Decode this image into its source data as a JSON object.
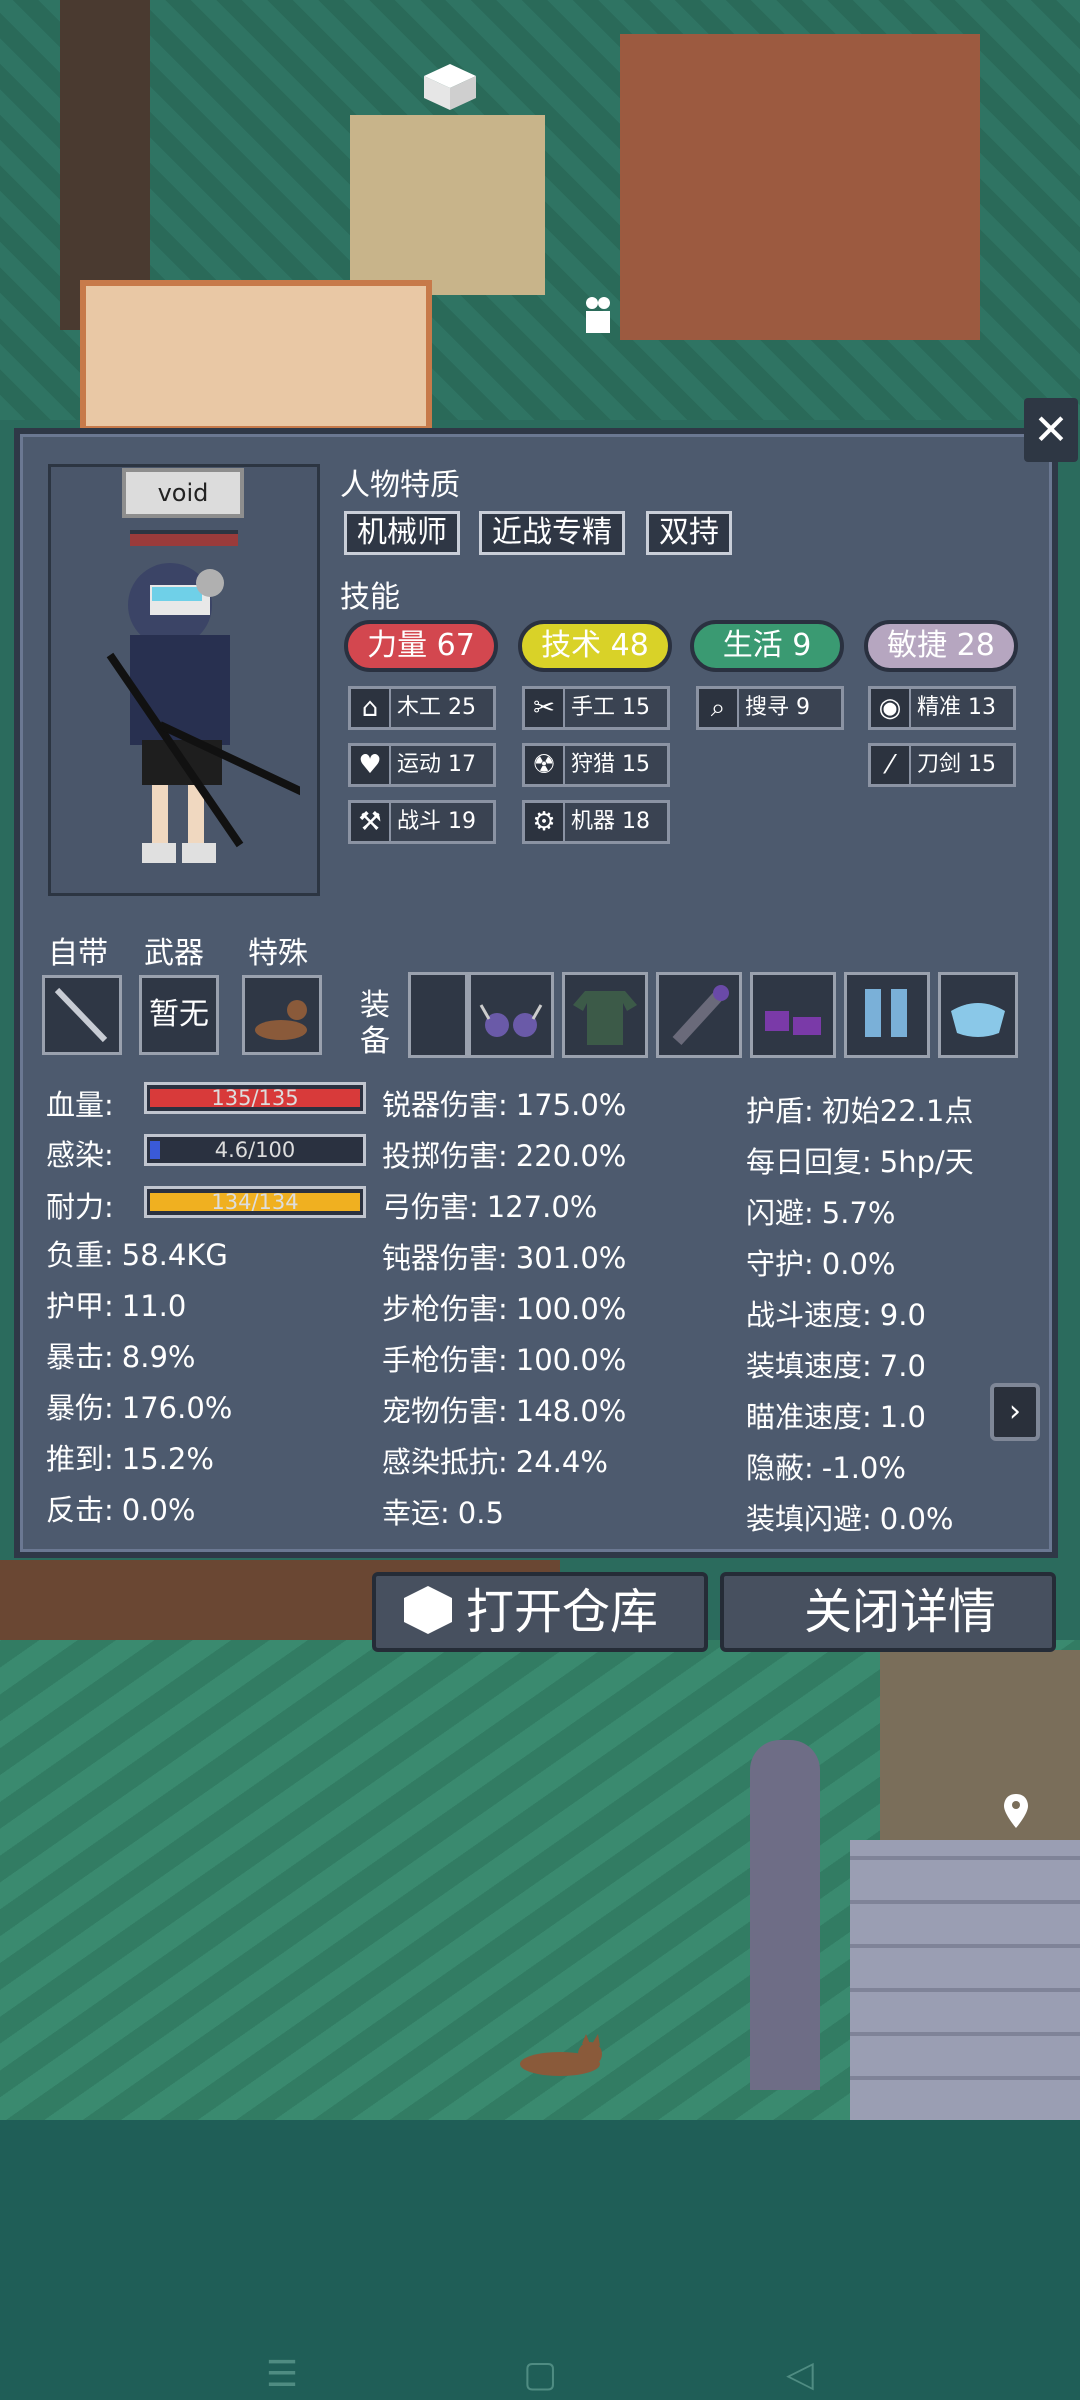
{
  "character": {
    "name": "void"
  },
  "traits": {
    "title": "人物特质",
    "items": [
      "机械师",
      "近战专精",
      "双持"
    ]
  },
  "skills": {
    "title": "技能",
    "main": [
      {
        "label": "力量 67",
        "color": "#d3474f"
      },
      {
        "label": "技术 48",
        "color": "#d9d228"
      },
      {
        "label": "生活 9",
        "color": "#3a9a72"
      },
      {
        "label": "敏捷 28",
        "color": "#b6a6c0"
      }
    ],
    "sub": [
      {
        "label": "木工 25",
        "icon": "house-icon"
      },
      {
        "label": "手工 15",
        "icon": "scissors-icon"
      },
      {
        "label": "搜寻 9",
        "icon": "magnifier-icon"
      },
      {
        "label": "精准 13",
        "icon": "eye-icon"
      },
      {
        "label": "运动 17",
        "icon": "heart-icon"
      },
      {
        "label": "狩猎 15",
        "icon": "radiation-icon"
      },
      {
        "label": "刀剑 15",
        "icon": "blade-icon"
      },
      {
        "label": "战斗 19",
        "icon": "axe-icon"
      },
      {
        "label": "机器 18",
        "icon": "gear-icon"
      }
    ]
  },
  "slots": {
    "builtin_label": "自带",
    "weapon_label": "武器",
    "special_label": "特殊",
    "weapon_empty": "暂无",
    "equip_label_1": "装",
    "equip_label_2": "备"
  },
  "vitals": [
    {
      "label": "血量:",
      "value": "135/135",
      "fraction": 1.0,
      "color": "#d83a3a"
    },
    {
      "label": "感染:",
      "value": "4.6/100",
      "fraction": 0.046,
      "color": "#3a5ad8"
    },
    {
      "label": "耐力:",
      "value": "134/134",
      "fraction": 1.0,
      "color": "#f0b020"
    }
  ],
  "attrs_col1": [
    {
      "label": "负重:",
      "value": "58.4KG"
    },
    {
      "label": "护甲:",
      "value": "11.0"
    },
    {
      "label": "暴击:",
      "value": "8.9%"
    },
    {
      "label": "暴伤:",
      "value": "176.0%"
    },
    {
      "label": "推到:",
      "value": "15.2%"
    },
    {
      "label": "反击:",
      "value": "0.0%"
    }
  ],
  "attrs_col2": [
    {
      "label": "锐器伤害:",
      "value": "175.0%"
    },
    {
      "label": "投掷伤害:",
      "value": "220.0%"
    },
    {
      "label": "弓伤害:",
      "value": "127.0%"
    },
    {
      "label": "钝器伤害:",
      "value": "301.0%"
    },
    {
      "label": "步枪伤害:",
      "value": "100.0%"
    },
    {
      "label": "手枪伤害:",
      "value": "100.0%"
    },
    {
      "label": "宠物伤害:",
      "value": "148.0%"
    },
    {
      "label": "感染抵抗:",
      "value": "24.4%"
    },
    {
      "label": "幸运:",
      "value": "0.5"
    }
  ],
  "attrs_col3": [
    {
      "label": "护盾:",
      "value": "初始22.1点"
    },
    {
      "label": "每日回复:",
      "value": "5hp/天"
    },
    {
      "label": "闪避:",
      "value": "5.7%"
    },
    {
      "label": "守护:",
      "value": "0.0%"
    },
    {
      "label": "战斗速度:",
      "value": "9.0"
    },
    {
      "label": "装填速度:",
      "value": "7.0"
    },
    {
      "label": "瞄准速度:",
      "value": "1.0"
    },
    {
      "label": "隐蔽:",
      "value": "-1.0%"
    },
    {
      "label": "装填闪避:",
      "value": "0.0%"
    }
  ],
  "buttons": {
    "open_storage": "打开仓库",
    "close_details": "关闭详情"
  }
}
